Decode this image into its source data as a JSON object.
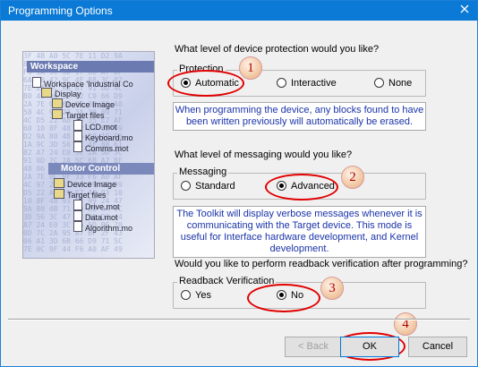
{
  "window": {
    "title": "Programming Options",
    "close_symbol": "✕"
  },
  "illustration": {
    "workspace_label": "Workspace",
    "tree": [
      "Workspace 'Industrial Co",
      "Display",
      "Device Image",
      "Target files",
      "LCD.mot",
      "Keyboard.mo",
      "Comms.mot"
    ],
    "motor_control_label": "Motor Control",
    "motor_tree": [
      "Device Image",
      "Target files",
      "Drive.mot",
      "Data.mot",
      "Algorithm.mo"
    ]
  },
  "protection": {
    "question": "What level of device protection would you like?",
    "group_label": "Protection",
    "options": [
      "Automatic",
      "Interactive",
      "None"
    ],
    "selected": "Automatic",
    "info": "When programming the device, any blocks found to have been written previously will automatically be erased."
  },
  "messaging": {
    "question": "What level of messaging would you like?",
    "group_label": "Messaging",
    "options": [
      "Standard",
      "Advanced"
    ],
    "selected": "Advanced",
    "info": "The Toolkit will display verbose messages whenever it is communicating with the Target device. This mode is useful for Interface hardware development, and Kernel development."
  },
  "readback": {
    "question": "Would you like to perform readback verification after programming?",
    "group_label": "Readback Verification",
    "options": [
      "Yes",
      "No"
    ],
    "selected": "No"
  },
  "annotations": {
    "marker_1": "1",
    "marker_2": "2",
    "marker_3": "3",
    "marker_4": "4",
    "color": "#e10000"
  },
  "buttons": {
    "back": "< Back",
    "ok": "OK",
    "cancel": "Cancel"
  }
}
